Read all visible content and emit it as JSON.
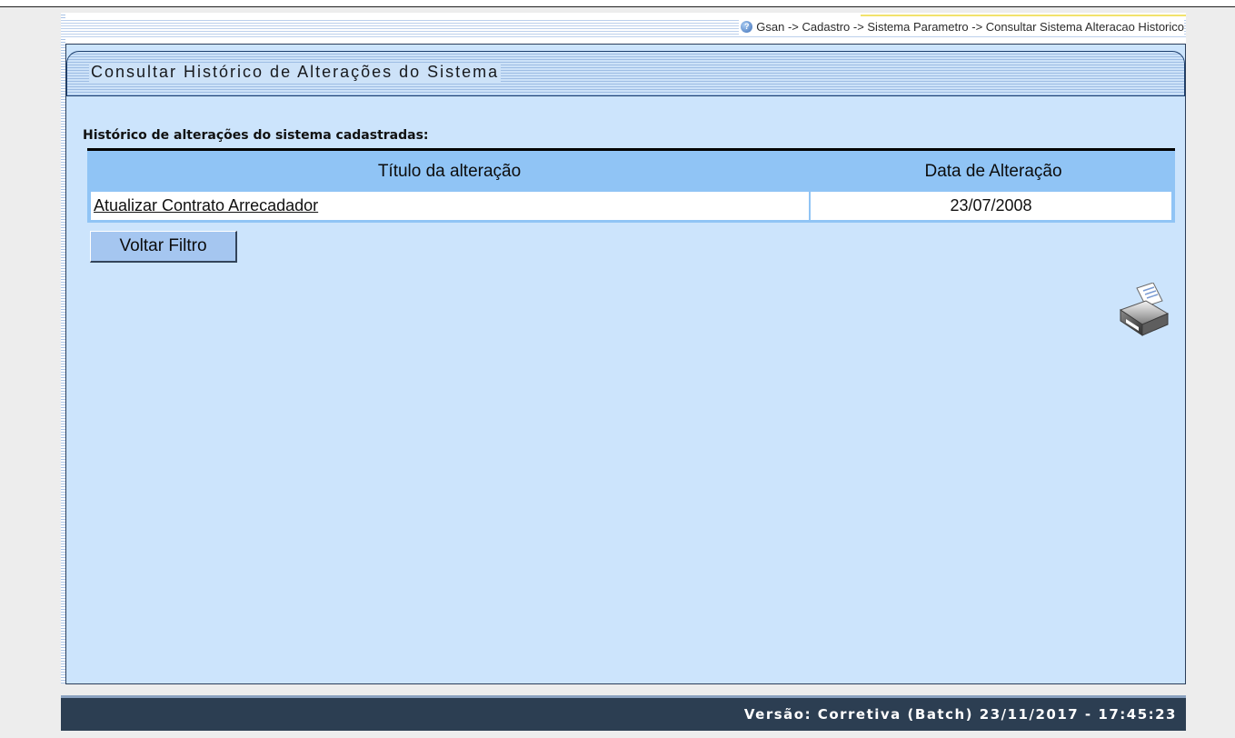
{
  "breadcrumb": {
    "text": "Gsan -> Cadastro -> Sistema Parametro -> Consultar Sistema Alteracao Historico",
    "icon": "help-icon"
  },
  "page": {
    "title": "Consultar Histórico de Alterações do Sistema",
    "section_label": "Histórico de alterações do sistema cadastradas:"
  },
  "table": {
    "columns": [
      "Título da alteração",
      "Data de Alteração"
    ],
    "rows": [
      {
        "title": "Atualizar Contrato Arrecadador",
        "date": "23/07/2008"
      }
    ]
  },
  "buttons": {
    "back_filter": "Voltar Filtro"
  },
  "footer": {
    "version": "Versão: Corretiva (Batch) 23/11/2017 - 17:45:23"
  },
  "colors": {
    "content_bg": "#cce4fc",
    "header_bg": "#90c4f5",
    "footer_bg": "#2c3e52",
    "button_bg": "#a5c6f0"
  }
}
